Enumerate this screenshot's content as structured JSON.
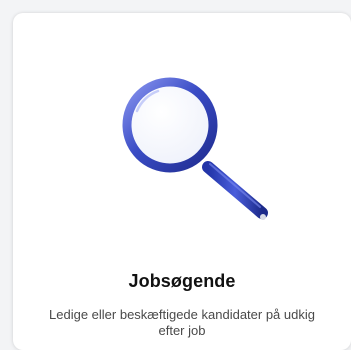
{
  "card": {
    "title": "Jobsøgende",
    "description": "Ledige eller beskæftigede kandidater på udkig efter job",
    "icon": "magnifying-glass-icon"
  },
  "colors": {
    "icon_blue": "#2d3fb3",
    "icon_blue_light": "#6f7fe6",
    "title": "#111111",
    "description": "#4a4a4a"
  }
}
